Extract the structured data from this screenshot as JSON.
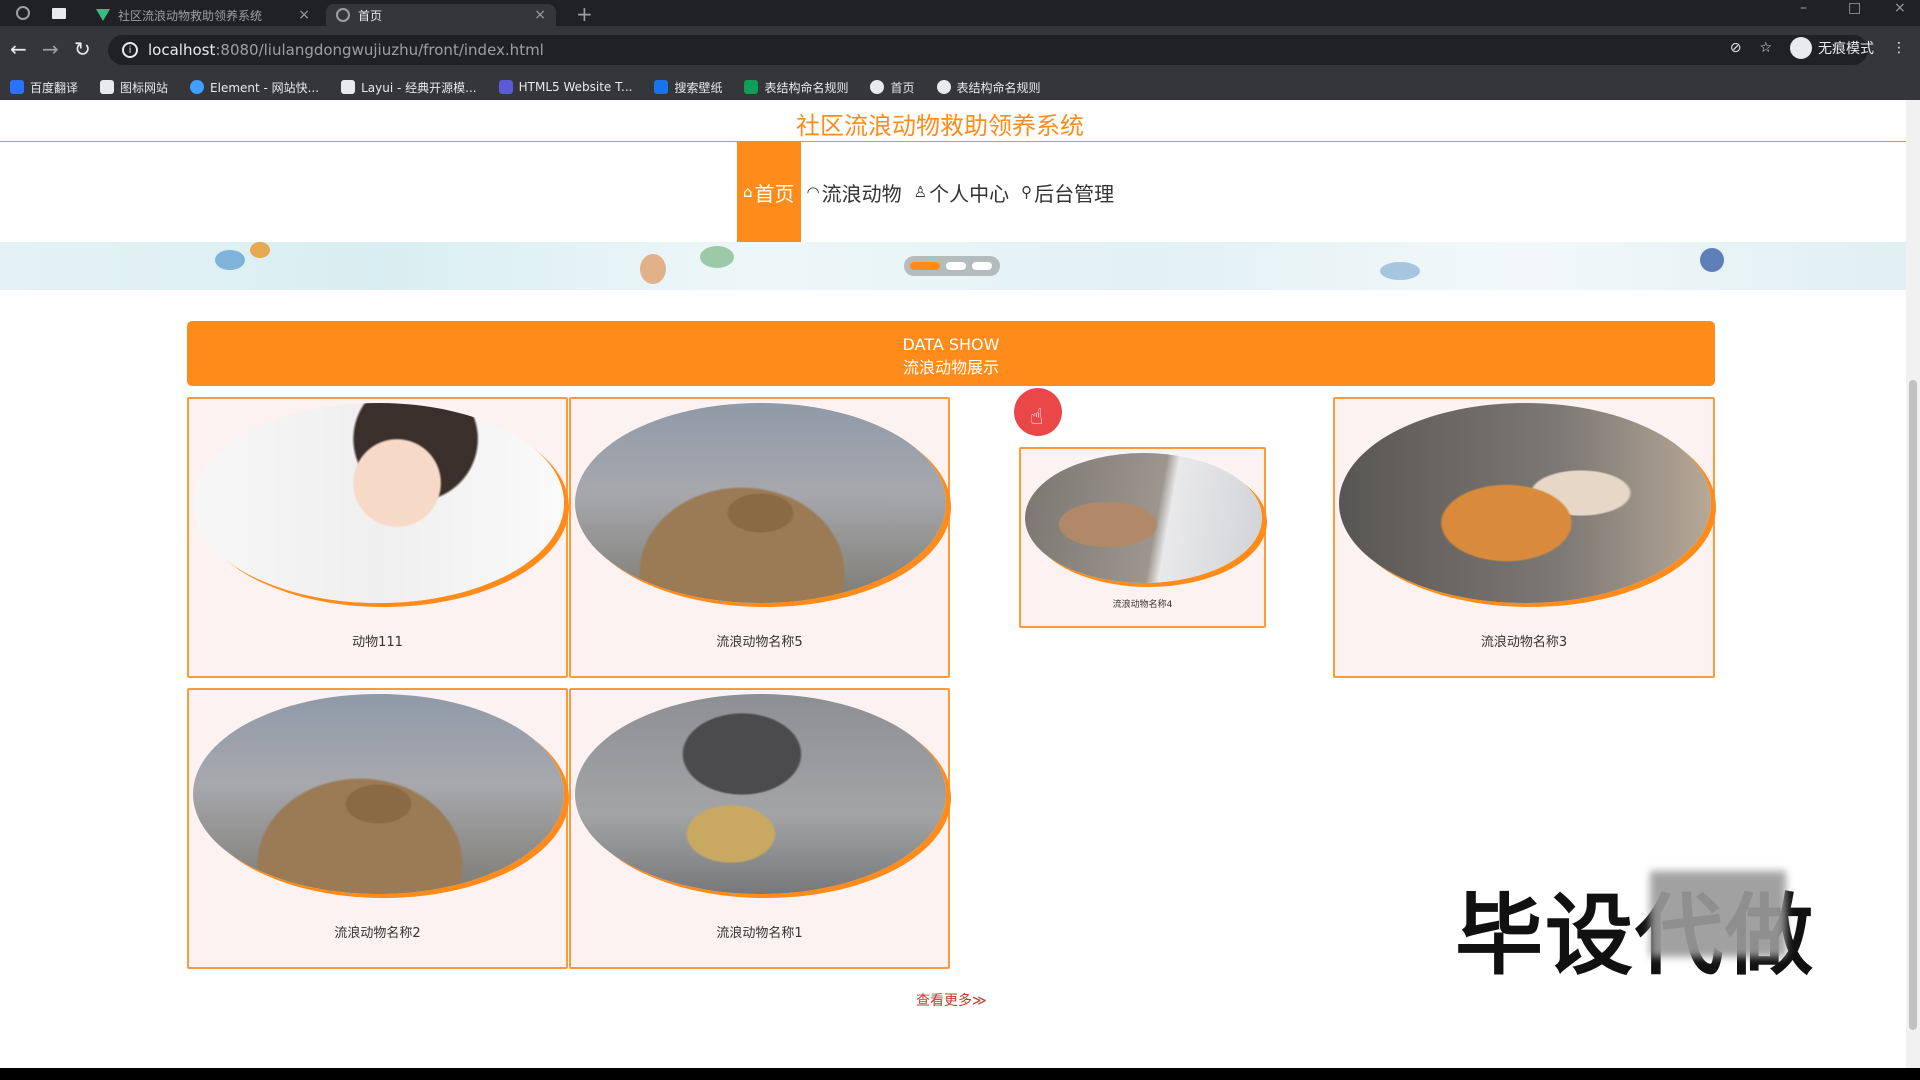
{
  "browser": {
    "tabs": [
      {
        "title": "社区流浪动物救助领养系统",
        "active": false,
        "favicon": "vue-logo-icon"
      },
      {
        "title": "首页",
        "active": true,
        "favicon": "globe-icon"
      }
    ],
    "url_host": "localhost",
    "url_rest": ":8080/liulangdongwujiuzhu/front/index.html",
    "incognito_label": "无痕模式",
    "bookmarks": [
      {
        "label": "百度翻译",
        "color": "#2b72ff"
      },
      {
        "label": "图标网站",
        "color": "#e8eaed"
      },
      {
        "label": "Element - 网站快...",
        "color": "#409eff"
      },
      {
        "label": "Layui - 经典开源模...",
        "color": "#e8eaed"
      },
      {
        "label": "HTML5 Website T...",
        "color": "#5b5bd6"
      },
      {
        "label": "搜索壁纸",
        "color": "#1a73e8"
      },
      {
        "label": "表结构命名规则",
        "color": "#0f9d58"
      },
      {
        "label": "首页",
        "color": "#e8eaed"
      },
      {
        "label": "表结构命名规则",
        "color": "#e8eaed"
      }
    ]
  },
  "site": {
    "title": "社区流浪动物救助领养系统",
    "nav": [
      {
        "label": "首页",
        "icon": "home-icon",
        "active": true
      },
      {
        "label": "流浪动物",
        "icon": "pet-icon",
        "active": false
      },
      {
        "label": "个人中心",
        "icon": "user-icon",
        "active": false
      },
      {
        "label": "后台管理",
        "icon": "link-icon",
        "active": false
      }
    ]
  },
  "section": {
    "title_en": "DATA SHOW",
    "title_cn": "流浪动物展示"
  },
  "cards": [
    {
      "name": "动物111"
    },
    {
      "name": "流浪动物名称5"
    },
    {
      "name": "流浪动物名称4"
    },
    {
      "name": "流浪动物名称3"
    },
    {
      "name": "流浪动物名称2"
    },
    {
      "name": "流浪动物名称1"
    }
  ],
  "more_link": "查看更多≫",
  "watermark": "毕设代做",
  "colors": {
    "accent": "#ff8c1a",
    "card_bg": "#fdf2f2"
  }
}
